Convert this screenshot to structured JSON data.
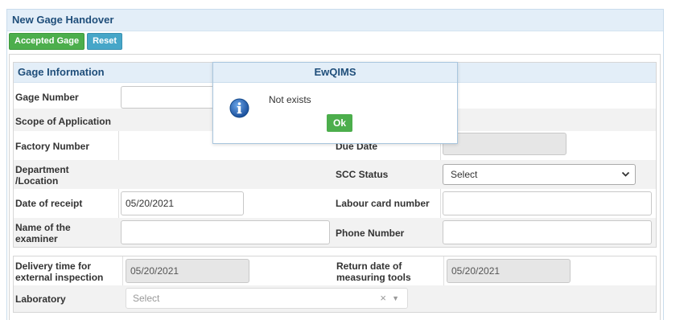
{
  "panel": {
    "title": "New Gage Handover"
  },
  "toolbar": {
    "accepted_label": "Accepted Gage",
    "reset_label": "Reset"
  },
  "gage_info": {
    "title": "Gage Information",
    "gage_number_label": "Gage Number",
    "gage_number_value": "",
    "scope_label": "Scope of Application",
    "factory_number_label": "Factory Number",
    "due_date_label": "Due Date",
    "due_date_value": "",
    "department_label": "Department\n/Location",
    "scc_status_label": "SCC Status",
    "scc_status_value": "Select",
    "date_receipt_label": "Date of receipt",
    "date_receipt_value": "05/20/2021",
    "labour_card_label": "Labour card number",
    "labour_card_value": "",
    "examiner_label": "Name of the\nexaminer",
    "examiner_value": "",
    "phone_label": "Phone Number",
    "phone_value": ""
  },
  "delivery": {
    "delivery_time_label": "Delivery time for\nexternal inspection",
    "delivery_time_value": "05/20/2021",
    "return_date_label": "Return date of\nmeasuring tools",
    "return_date_value": "05/20/2021",
    "laboratory_label": "Laboratory",
    "laboratory_placeholder": "Select",
    "clear_symbol": "×",
    "dropdown_symbol": "▼"
  },
  "dialog": {
    "title": "EwQIMS",
    "message": "Not exists",
    "ok_label": "Ok",
    "icon": "info-icon"
  },
  "colors": {
    "header_bg": "#e3eef8",
    "header_text": "#1f4e7a",
    "green": "#4cae4c",
    "teal": "#46a6c8",
    "info_blue": "#1a5fb4"
  }
}
